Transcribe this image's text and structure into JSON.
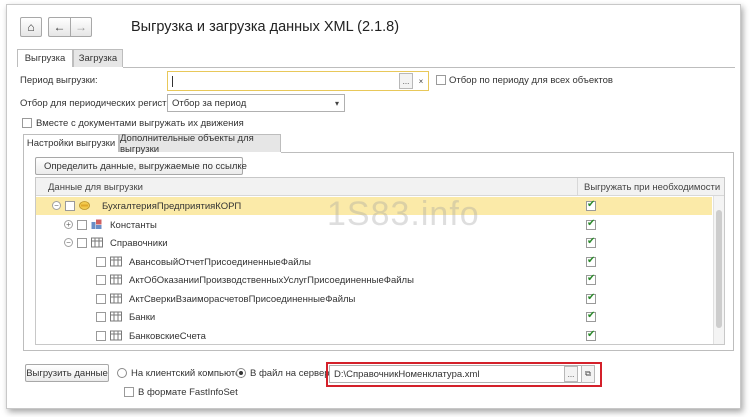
{
  "window": {
    "title": "Выгрузка и загрузка данных XML (2.1.8)"
  },
  "toolbar": {
    "home_glyph": "⌂",
    "back_glyph": "←",
    "forward_glyph": "→"
  },
  "main_tabs": [
    {
      "label": "Выгрузка",
      "active": true
    },
    {
      "label": "Загрузка",
      "active": false
    }
  ],
  "period": {
    "label": "Период выгрузки:",
    "value": "",
    "select_glyph": "...",
    "clear_glyph": "×",
    "filter_all_label": "Отбор по периоду для всех объектов",
    "filter_all_checked": false
  },
  "registers": {
    "label": "Отбор для периодических регистров:",
    "value": "Отбор за период",
    "dropdown_glyph": "▾"
  },
  "with_documents": {
    "label": "Вместе с документами выгружать их движения",
    "checked": false
  },
  "settings_tabs": [
    {
      "label": "Настройки выгрузки",
      "active": true
    },
    {
      "label": "Дополнительные объекты для выгрузки",
      "active": false
    }
  ],
  "define_button": {
    "label": "Определить данные, выгружаемые по ссылке"
  },
  "grid": {
    "col1": "Данные для выгрузки",
    "col2": "Выгружать при необходимости",
    "rows": [
      {
        "label": "БухгалтерияПредприятияКОРП",
        "level": 0,
        "expander": "⊖",
        "checked": false,
        "export": true,
        "selected": true,
        "icon": "config-icon"
      },
      {
        "label": "Константы",
        "level": 1,
        "expander": "⊕",
        "checked": false,
        "export": true,
        "selected": false,
        "icon": "constants-icon"
      },
      {
        "label": "Справочники",
        "level": 1,
        "expander": "⊖",
        "checked": false,
        "export": true,
        "selected": false,
        "icon": "catalog-icon"
      },
      {
        "label": "АвансовыйОтчетПрисоединенныеФайлы",
        "level": 2,
        "expander": "",
        "checked": false,
        "export": true,
        "selected": false,
        "icon": "catalog-icon"
      },
      {
        "label": "АктОбОказанииПроизводственныхУслугПрисоединенныеФайлы",
        "level": 2,
        "expander": "",
        "checked": false,
        "export": true,
        "selected": false,
        "icon": "catalog-icon"
      },
      {
        "label": "АктСверкиВзаиморасчетовПрисоединенныеФайлы",
        "level": 2,
        "expander": "",
        "checked": false,
        "export": true,
        "selected": false,
        "icon": "catalog-icon"
      },
      {
        "label": "Банки",
        "level": 2,
        "expander": "",
        "checked": false,
        "export": true,
        "selected": false,
        "icon": "catalog-icon"
      },
      {
        "label": "БанковскиеСчета",
        "level": 2,
        "expander": "",
        "checked": false,
        "export": true,
        "selected": false,
        "icon": "catalog-icon"
      }
    ]
  },
  "bottom": {
    "export_button": "Выгрузить данные",
    "radio_client": "На клиентский компьютер",
    "radio_server": "В файл на сервере",
    "server_selected": true,
    "file_path": "D:\\СправочникНоменклатура.xml",
    "file_select_glyph": "...",
    "file_open_glyph": "⧉",
    "fastinfoset_label": "В формате FastInfoSet",
    "fastinfoset_checked": false
  },
  "watermark": "1S83.info"
}
